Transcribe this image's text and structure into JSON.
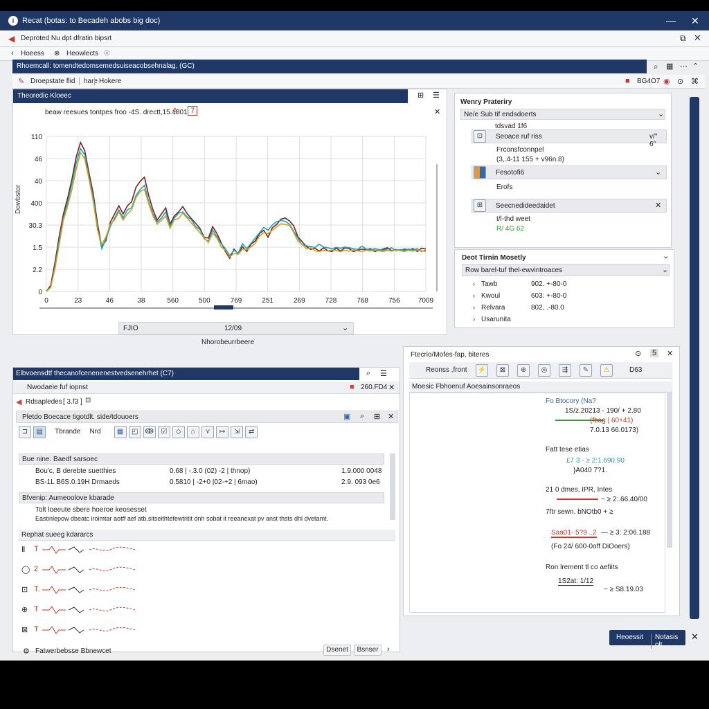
{
  "window": {
    "title": "Recat (botas: to Becadeh abobs big doc)",
    "minimize": "—",
    "close": "✕"
  },
  "ribbon": {
    "title": "Deproted Nu dpt dfratin bipsrt"
  },
  "breadcrumb": {
    "home": "Hoeess",
    "sep": "⊗",
    "item": "Heowlects"
  },
  "main_header": {
    "title": "Rhoemcall: tomendtedomsemedsuiseacobsehnalag, (GC)"
  },
  "tabs": {
    "tab1": "Droepstate flid",
    "tab2": "hare",
    "tab3": "Hokere",
    "right_value": "BG4O7"
  },
  "chart_panel": {
    "title": "Theoredic Kloeec",
    "annotation": "beaw reesues tontpes froo -4S. drectt,15.1801",
    "ylabel": "Dowbstor",
    "xlabel": "Nhorobeurrbeere",
    "dropdown_left": "FJIO",
    "dropdown_value": "12/09"
  },
  "chart_data": {
    "type": "line",
    "x_tick_labels": [
      "0",
      "23",
      "46",
      "38",
      "560",
      "500",
      "769",
      "251",
      "269",
      "728",
      "768",
      "756",
      "7009"
    ],
    "y_tick_labels": [
      "0",
      "2.2",
      "1.5",
      "30.3",
      "400",
      "40",
      "46",
      "110"
    ],
    "series": [
      {
        "color": "#7a1f1f",
        "values": [
          0,
          0.3,
          1.4,
          2.7,
          3.8,
          4.6,
          5.5,
          6.6,
          7.3,
          6.9,
          5.8,
          4.8,
          3.3,
          2.2,
          2.5,
          3.4,
          3.8,
          4.2,
          3.8,
          4.2,
          4.4,
          5.1,
          5.4,
          5.6,
          4.7,
          4.0,
          3.5,
          3.8,
          4.1,
          3.3,
          3.7,
          3.9,
          4.2,
          3.8,
          3.6,
          3.3,
          3.1,
          2.7,
          2.6,
          3.2,
          2.8,
          2.4,
          2.0,
          1.6,
          2.1,
          1.8,
          2.2,
          2.0,
          2.3,
          2.5,
          2.8,
          3.0,
          2.7,
          3.1,
          3.3,
          3.5,
          3.6,
          3.5,
          3.2,
          2.7,
          2.4,
          2.2,
          2.1,
          2.1,
          2.0,
          2.1,
          2.0,
          2.0,
          2.1,
          2.0,
          2.1,
          2.1,
          2.0,
          2.0,
          2.1,
          2.0,
          2.1,
          2.0,
          2.0,
          2.1,
          2.1,
          2.0,
          2.1,
          2.0,
          2.1,
          2.0,
          2.1,
          2.0,
          2.1,
          2.1
        ]
      },
      {
        "color": "#1c9fb7",
        "values": [
          0,
          0.2,
          1.2,
          2.5,
          3.6,
          4.4,
          5.3,
          6.3,
          7.0,
          6.7,
          5.6,
          4.6,
          3.1,
          2.1,
          2.6,
          3.2,
          3.6,
          4.0,
          3.6,
          4.0,
          4.1,
          4.7,
          5.0,
          5.2,
          4.4,
          3.8,
          3.4,
          3.6,
          3.9,
          3.2,
          3.6,
          3.8,
          3.9,
          3.7,
          3.5,
          3.2,
          3.0,
          2.6,
          2.5,
          3.0,
          2.7,
          2.3,
          2.1,
          1.8,
          2.0,
          1.9,
          2.3,
          2.1,
          2.4,
          2.6,
          2.9,
          3.1,
          3.0,
          3.3,
          3.4,
          3.5,
          3.4,
          3.3,
          3.0,
          2.6,
          2.3,
          2.2,
          2.2,
          2.2,
          2.3,
          2.2,
          2.1,
          2.1,
          2.2,
          2.1,
          2.2,
          2.1,
          2.1,
          2.1,
          2.2,
          2.1,
          2.0,
          2.1,
          2.1,
          2.0,
          2.1,
          2.1,
          2.0,
          2.1,
          2.0,
          2.1,
          2.0,
          2.1,
          2.0,
          2.0
        ]
      },
      {
        "color": "#c9a227",
        "values": [
          0,
          0.2,
          1.1,
          2.3,
          3.5,
          4.2,
          5.0,
          6.0,
          6.8,
          6.5,
          5.5,
          4.4,
          3.0,
          2.3,
          2.7,
          3.3,
          3.5,
          3.9,
          3.5,
          3.8,
          4.0,
          4.6,
          4.9,
          5.0,
          4.3,
          3.7,
          3.3,
          3.5,
          3.7,
          3.1,
          3.5,
          3.6,
          3.8,
          3.6,
          3.4,
          3.1,
          2.9,
          2.6,
          2.4,
          2.9,
          2.6,
          2.2,
          2.0,
          1.7,
          1.9,
          1.8,
          2.1,
          2.0,
          2.2,
          2.4,
          2.7,
          2.9,
          2.8,
          3.0,
          3.2,
          3.3,
          3.3,
          3.2,
          2.9,
          2.5,
          2.3,
          2.1,
          2.1,
          2.0,
          2.0,
          2.0,
          2.0,
          2.0,
          2.0,
          2.0,
          2.0,
          2.0,
          2.0,
          2.0,
          2.0,
          2.0,
          2.0,
          2.0,
          2.0,
          2.0,
          2.0,
          2.0,
          2.0,
          2.0,
          2.0,
          2.0,
          2.0,
          2.0,
          2.0,
          2.0
        ]
      }
    ]
  },
  "property_panel": {
    "title": "Wenry Prateriry",
    "dropdown": "Ne/e Sub tif endsdoerts",
    "caption": "tdsvad 1f6",
    "card1": {
      "title": "Seoace ruf riss",
      "value": "v/° 6°",
      "line1": "Frconsfconnpel",
      "line2": "(3,.4-11 155 + v96n.8)"
    },
    "card2": {
      "title": "Fesotofi6",
      "line1": "Erofs"
    },
    "card3": {
      "title": "Seecnedideedaidet",
      "line1": "t/l-thd weet",
      "line2": "R/ 4G 62"
    }
  },
  "timing_panel": {
    "title": "Deot Tirnin Mosetly",
    "dropdown": "Row barel-tuf thel-ewvintroaces",
    "rows": [
      {
        "label": "Tawb",
        "value": "902. +-80-0"
      },
      {
        "label": "Kwoul",
        "value": "603: +-80-0"
      },
      {
        "label": "Relvara",
        "value": "802, .-80.0"
      },
      {
        "label": "Usarunita",
        "value": ""
      }
    ]
  },
  "bottom_left": {
    "title": "Elbvoensdtf thecanofcenenenestvedsenehrhet (C7)",
    "subtitle": "Nwodaeie fuf iopnst",
    "sub_value": "260.FD4",
    "row1": "Rdsapledes",
    "row1_val": "[ 3.f3 ]",
    "section_title": "Pletdo Boecace tigotdlt. side/tdouoers",
    "tb_a": "Tbrande",
    "tb_b": "Nrd",
    "grp1": {
      "title": "Bue nine. Baedf sarsoec",
      "rows": [
        {
          "a": "Bou'c, B derebte suetthies",
          "b": "0.68 | -.3.0 (02) -2 | thnop)",
          "c": "1.9.000 0048"
        },
        {
          "a": "BS-1L B6S.0.19H Drmaeds",
          "b": "0.5810 | -2+0 |02-+2 | 6mao)",
          "c": "2.9. 093 0e6"
        }
      ]
    },
    "grp2": {
      "title": "Bfvenip: Aumeoolove kbarade",
      "l1": "Tolt loeeute sbere hoeroe keosesset",
      "l2": "Eastinlepow dbeatc iroimtar aotff aef atb.sitseithtefewtritit dnh sobat it reeanexat pv anst thsts dhl dvetamt."
    },
    "grp3": {
      "title": "Rephat sueeg kdararcs",
      "rows": [
        {
          "i": "Ⅱ",
          "t": "T"
        },
        {
          "i": "◯",
          "t": "2"
        },
        {
          "i": "⊡",
          "t": "T."
        },
        {
          "i": "⊕",
          "t": "T"
        },
        {
          "i": "⊠",
          "t": "T"
        }
      ]
    },
    "footer_text": "Fatwerbebsse Bbnewcet",
    "btn1": "Dsenet",
    "btn2": "Bsnser"
  },
  "bottom_right": {
    "title": "Ftecrio/Mofes-fap, biteres",
    "tbtitle": "Reonss  ,front",
    "tbvalue": "D63",
    "section": "Moesic Fbhoenuf Aoesainsonraeos",
    "f1": {
      "a": "Fo Btocory  (Na?",
      "b": "1S/z.20213 - 190/ + 2.80",
      "c": "(fbag  | 60+41)",
      "d": "7.0.13 66.0173)"
    },
    "f2": {
      "h": "Fatt tese etias",
      "a": "£7 3  - ≥ 2:1.690.90",
      "b": "}A040 7?1."
    },
    "f3": {
      "h": "21 0 dmes, IPR, Intes",
      "a": "~ ≥ 2:.66.40/00",
      "b": "7ftr sewn. bNOtb0 + ≥"
    },
    "f4": {
      "a": "Saa01- 5?9 ..2",
      "b": "— ≥ 3: 2:06.188",
      "c": "(Fo 24/ 600-0off DiOoers)"
    },
    "f5": {
      "h": "Ron lrement tl co aefiits",
      "a": "1S2at: 1/12",
      "b": "− ≥ S8.19.03"
    }
  },
  "footer": {
    "btn_a": "Heoessit",
    "btn_b": "Notasis olt"
  }
}
